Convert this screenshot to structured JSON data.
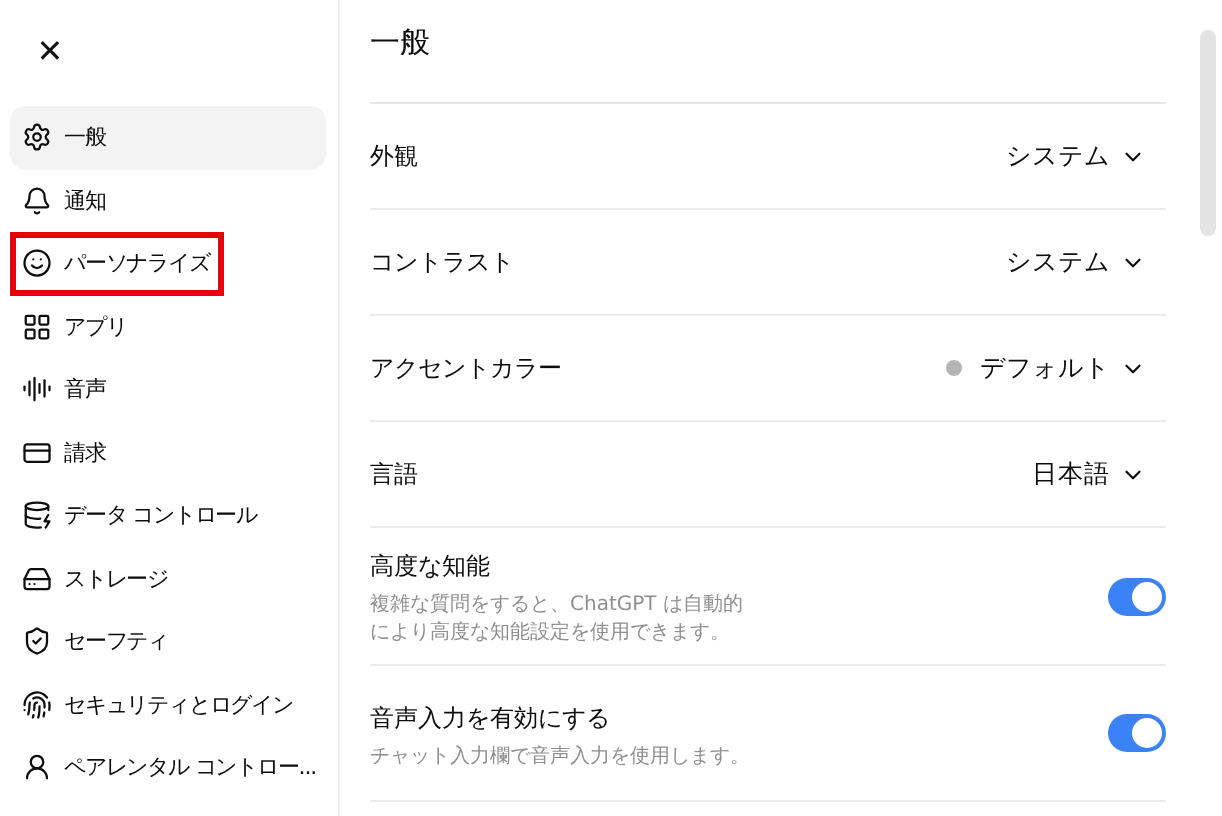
{
  "close_button": {
    "label": "✕"
  },
  "sidebar": {
    "items": [
      {
        "label": "一般",
        "selected": true,
        "highlighted": false
      },
      {
        "label": "通知",
        "selected": false,
        "highlighted": false
      },
      {
        "label": "パーソナライズ",
        "selected": false,
        "highlighted": true
      },
      {
        "label": "アプリ",
        "selected": false,
        "highlighted": false
      },
      {
        "label": "音声",
        "selected": false,
        "highlighted": false
      },
      {
        "label": "請求",
        "selected": false,
        "highlighted": false
      },
      {
        "label": "データ コントロール",
        "selected": false,
        "highlighted": false
      },
      {
        "label": "ストレージ",
        "selected": false,
        "highlighted": false
      },
      {
        "label": "セーフティ",
        "selected": false,
        "highlighted": false
      },
      {
        "label": "セキュリティとログイン",
        "selected": false,
        "highlighted": false
      },
      {
        "label": "ペアレンタル コントロー...",
        "selected": false,
        "highlighted": false
      }
    ]
  },
  "panel": {
    "title": "一般",
    "settings": [
      {
        "kind": "select",
        "label": "外観",
        "value": "システム"
      },
      {
        "kind": "select",
        "label": "コントラスト",
        "value": "システム"
      },
      {
        "kind": "select",
        "label": "アクセントカラー",
        "value": "デフォルト",
        "color": "#b4b4b4"
      },
      {
        "kind": "select",
        "label": "言語",
        "value": "日本語"
      },
      {
        "kind": "toggle",
        "label": "高度な知能",
        "description": "複雑な質問をすると、ChatGPT は自動的により高度な知能設定を使用できます。",
        "on": true
      },
      {
        "kind": "toggle",
        "label": "音声入力を有効にする",
        "description": "チャット入力欄で音声入力を使用します。",
        "on": true
      }
    ]
  }
}
